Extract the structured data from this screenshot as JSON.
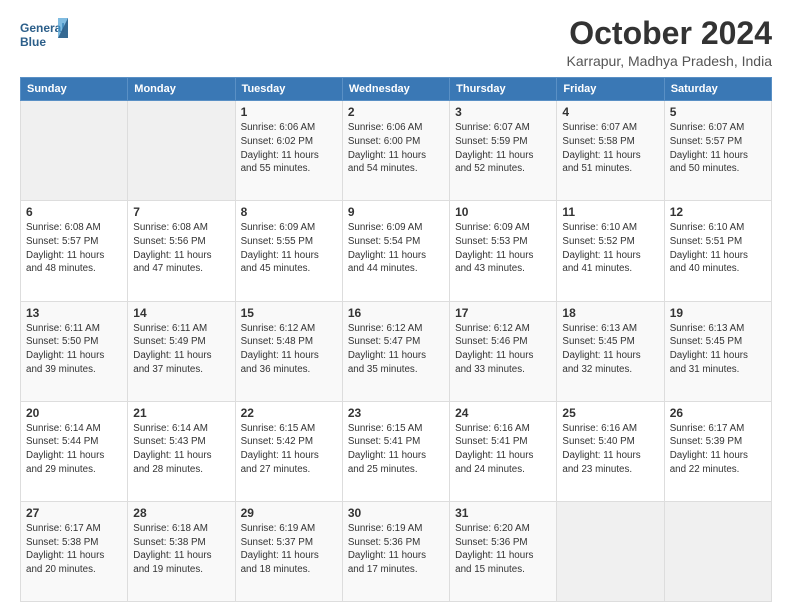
{
  "header": {
    "logo_line1": "General",
    "logo_line2": "Blue",
    "month": "October 2024",
    "location": "Karrapur, Madhya Pradesh, India"
  },
  "weekdays": [
    "Sunday",
    "Monday",
    "Tuesday",
    "Wednesday",
    "Thursday",
    "Friday",
    "Saturday"
  ],
  "weeks": [
    [
      {
        "day": "",
        "sunrise": "",
        "sunset": "",
        "daylight": ""
      },
      {
        "day": "",
        "sunrise": "",
        "sunset": "",
        "daylight": ""
      },
      {
        "day": "1",
        "sunrise": "Sunrise: 6:06 AM",
        "sunset": "Sunset: 6:02 PM",
        "daylight": "Daylight: 11 hours and 55 minutes."
      },
      {
        "day": "2",
        "sunrise": "Sunrise: 6:06 AM",
        "sunset": "Sunset: 6:00 PM",
        "daylight": "Daylight: 11 hours and 54 minutes."
      },
      {
        "day": "3",
        "sunrise": "Sunrise: 6:07 AM",
        "sunset": "Sunset: 5:59 PM",
        "daylight": "Daylight: 11 hours and 52 minutes."
      },
      {
        "day": "4",
        "sunrise": "Sunrise: 6:07 AM",
        "sunset": "Sunset: 5:58 PM",
        "daylight": "Daylight: 11 hours and 51 minutes."
      },
      {
        "day": "5",
        "sunrise": "Sunrise: 6:07 AM",
        "sunset": "Sunset: 5:57 PM",
        "daylight": "Daylight: 11 hours and 50 minutes."
      }
    ],
    [
      {
        "day": "6",
        "sunrise": "Sunrise: 6:08 AM",
        "sunset": "Sunset: 5:57 PM",
        "daylight": "Daylight: 11 hours and 48 minutes."
      },
      {
        "day": "7",
        "sunrise": "Sunrise: 6:08 AM",
        "sunset": "Sunset: 5:56 PM",
        "daylight": "Daylight: 11 hours and 47 minutes."
      },
      {
        "day": "8",
        "sunrise": "Sunrise: 6:09 AM",
        "sunset": "Sunset: 5:55 PM",
        "daylight": "Daylight: 11 hours and 45 minutes."
      },
      {
        "day": "9",
        "sunrise": "Sunrise: 6:09 AM",
        "sunset": "Sunset: 5:54 PM",
        "daylight": "Daylight: 11 hours and 44 minutes."
      },
      {
        "day": "10",
        "sunrise": "Sunrise: 6:09 AM",
        "sunset": "Sunset: 5:53 PM",
        "daylight": "Daylight: 11 hours and 43 minutes."
      },
      {
        "day": "11",
        "sunrise": "Sunrise: 6:10 AM",
        "sunset": "Sunset: 5:52 PM",
        "daylight": "Daylight: 11 hours and 41 minutes."
      },
      {
        "day": "12",
        "sunrise": "Sunrise: 6:10 AM",
        "sunset": "Sunset: 5:51 PM",
        "daylight": "Daylight: 11 hours and 40 minutes."
      }
    ],
    [
      {
        "day": "13",
        "sunrise": "Sunrise: 6:11 AM",
        "sunset": "Sunset: 5:50 PM",
        "daylight": "Daylight: 11 hours and 39 minutes."
      },
      {
        "day": "14",
        "sunrise": "Sunrise: 6:11 AM",
        "sunset": "Sunset: 5:49 PM",
        "daylight": "Daylight: 11 hours and 37 minutes."
      },
      {
        "day": "15",
        "sunrise": "Sunrise: 6:12 AM",
        "sunset": "Sunset: 5:48 PM",
        "daylight": "Daylight: 11 hours and 36 minutes."
      },
      {
        "day": "16",
        "sunrise": "Sunrise: 6:12 AM",
        "sunset": "Sunset: 5:47 PM",
        "daylight": "Daylight: 11 hours and 35 minutes."
      },
      {
        "day": "17",
        "sunrise": "Sunrise: 6:12 AM",
        "sunset": "Sunset: 5:46 PM",
        "daylight": "Daylight: 11 hours and 33 minutes."
      },
      {
        "day": "18",
        "sunrise": "Sunrise: 6:13 AM",
        "sunset": "Sunset: 5:45 PM",
        "daylight": "Daylight: 11 hours and 32 minutes."
      },
      {
        "day": "19",
        "sunrise": "Sunrise: 6:13 AM",
        "sunset": "Sunset: 5:45 PM",
        "daylight": "Daylight: 11 hours and 31 minutes."
      }
    ],
    [
      {
        "day": "20",
        "sunrise": "Sunrise: 6:14 AM",
        "sunset": "Sunset: 5:44 PM",
        "daylight": "Daylight: 11 hours and 29 minutes."
      },
      {
        "day": "21",
        "sunrise": "Sunrise: 6:14 AM",
        "sunset": "Sunset: 5:43 PM",
        "daylight": "Daylight: 11 hours and 28 minutes."
      },
      {
        "day": "22",
        "sunrise": "Sunrise: 6:15 AM",
        "sunset": "Sunset: 5:42 PM",
        "daylight": "Daylight: 11 hours and 27 minutes."
      },
      {
        "day": "23",
        "sunrise": "Sunrise: 6:15 AM",
        "sunset": "Sunset: 5:41 PM",
        "daylight": "Daylight: 11 hours and 25 minutes."
      },
      {
        "day": "24",
        "sunrise": "Sunrise: 6:16 AM",
        "sunset": "Sunset: 5:41 PM",
        "daylight": "Daylight: 11 hours and 24 minutes."
      },
      {
        "day": "25",
        "sunrise": "Sunrise: 6:16 AM",
        "sunset": "Sunset: 5:40 PM",
        "daylight": "Daylight: 11 hours and 23 minutes."
      },
      {
        "day": "26",
        "sunrise": "Sunrise: 6:17 AM",
        "sunset": "Sunset: 5:39 PM",
        "daylight": "Daylight: 11 hours and 22 minutes."
      }
    ],
    [
      {
        "day": "27",
        "sunrise": "Sunrise: 6:17 AM",
        "sunset": "Sunset: 5:38 PM",
        "daylight": "Daylight: 11 hours and 20 minutes."
      },
      {
        "day": "28",
        "sunrise": "Sunrise: 6:18 AM",
        "sunset": "Sunset: 5:38 PM",
        "daylight": "Daylight: 11 hours and 19 minutes."
      },
      {
        "day": "29",
        "sunrise": "Sunrise: 6:19 AM",
        "sunset": "Sunset: 5:37 PM",
        "daylight": "Daylight: 11 hours and 18 minutes."
      },
      {
        "day": "30",
        "sunrise": "Sunrise: 6:19 AM",
        "sunset": "Sunset: 5:36 PM",
        "daylight": "Daylight: 11 hours and 17 minutes."
      },
      {
        "day": "31",
        "sunrise": "Sunrise: 6:20 AM",
        "sunset": "Sunset: 5:36 PM",
        "daylight": "Daylight: 11 hours and 15 minutes."
      },
      {
        "day": "",
        "sunrise": "",
        "sunset": "",
        "daylight": ""
      },
      {
        "day": "",
        "sunrise": "",
        "sunset": "",
        "daylight": ""
      }
    ]
  ]
}
